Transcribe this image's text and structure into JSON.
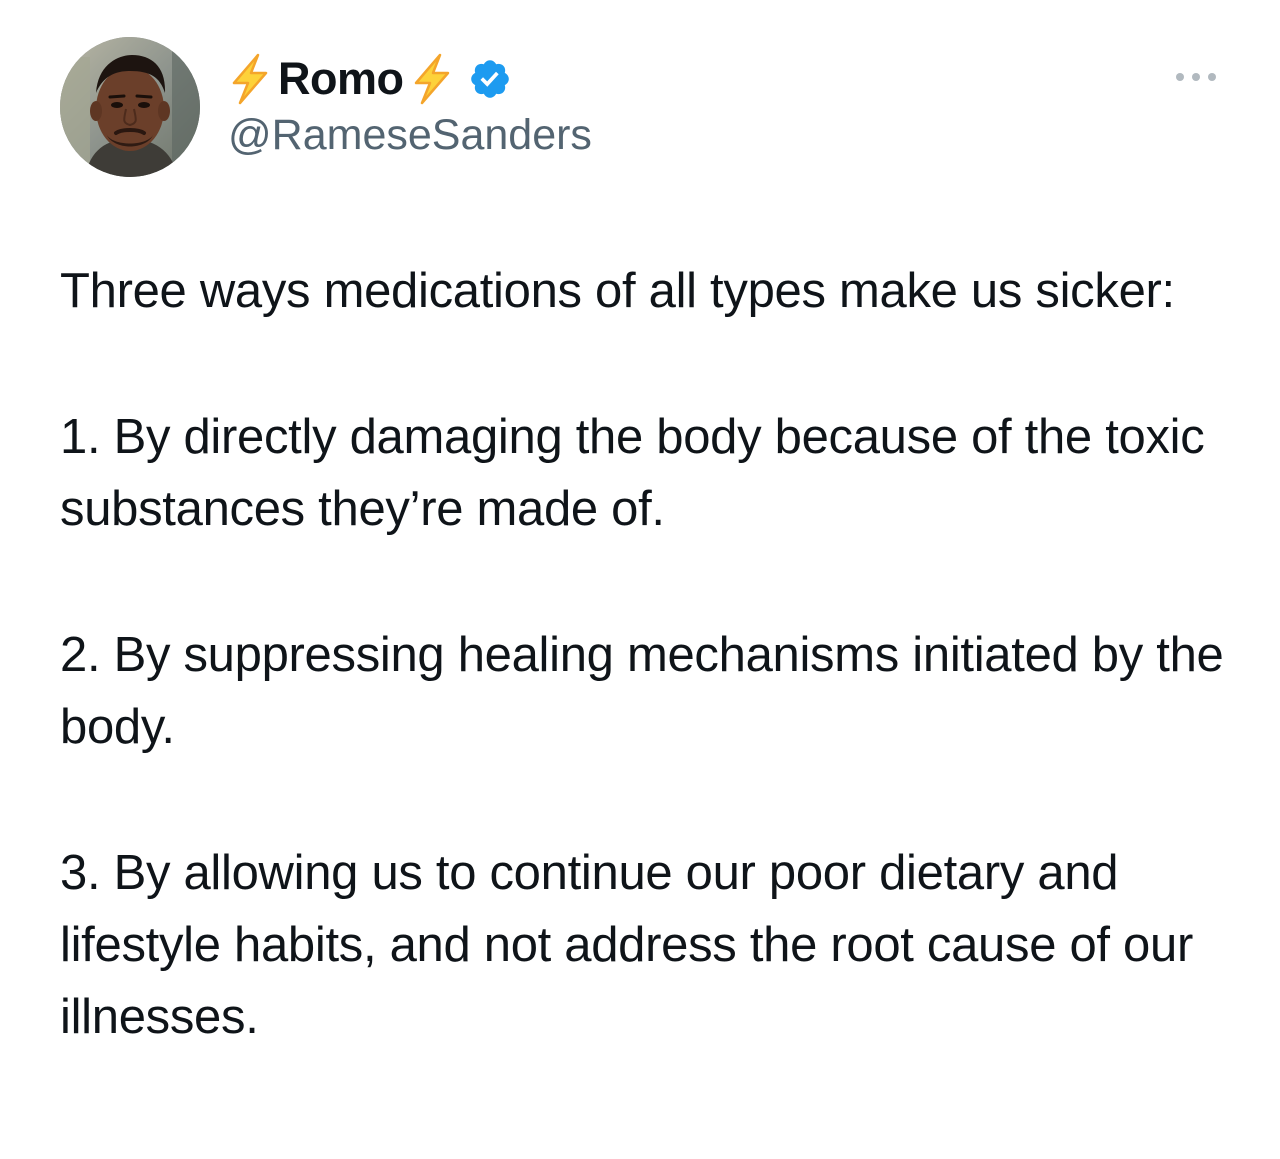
{
  "tweet": {
    "author": {
      "display_name": "Romo",
      "handle": "@RameseSanders",
      "verified": true,
      "name_emoji": "lightning-bolt"
    },
    "paragraphs": [
      "Three ways medications of all types make us sicker:",
      "1. By directly damaging the body because of the toxic substances they’re made of.",
      "2. By suppressing healing mechanisms initiated by the body.",
      "3. By allowing us to continue our poor dietary and lifestyle habits, and not address the root cause of our illnesses."
    ]
  },
  "colors": {
    "text": "#0f1419",
    "secondary_text": "#536471",
    "verified_blue": "#1d9bf0",
    "bolt_yellow": "#fdd23a",
    "bolt_orange": "#f4a52b"
  }
}
